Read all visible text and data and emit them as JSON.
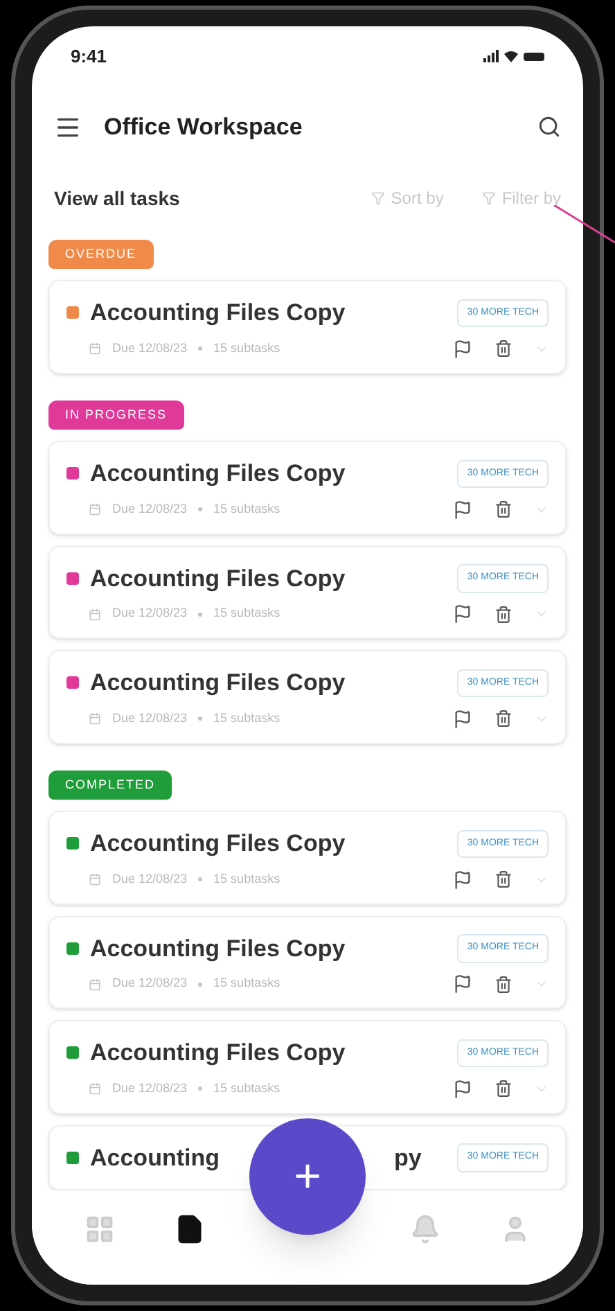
{
  "status_bar": {
    "time": "9:41"
  },
  "header": {
    "title": "Office Workspace"
  },
  "toolbar": {
    "heading": "View all tasks",
    "sort": "Sort by",
    "filter": "Filter by"
  },
  "groups": [
    {
      "label": "OVERDUE",
      "color": "#f08a4b",
      "tasks": [
        {
          "title": "Accounting Files Copy",
          "tag": "30 MORE TECH",
          "due": "Due 12/08/23",
          "subtasks": "15 subtasks"
        }
      ]
    },
    {
      "label": "IN PROGRESS",
      "color": "#e0399a",
      "tasks": [
        {
          "title": "Accounting Files Copy",
          "tag": "30 MORE TECH",
          "due": "Due 12/08/23",
          "subtasks": "15 subtasks"
        },
        {
          "title": "Accounting Files Copy",
          "tag": "30 MORE TECH",
          "due": "Due 12/08/23",
          "subtasks": "15 subtasks"
        },
        {
          "title": "Accounting Files Copy",
          "tag": "30 MORE TECH",
          "due": "Due 12/08/23",
          "subtasks": "15 subtasks"
        }
      ]
    },
    {
      "label": "COMPLETED",
      "color": "#1f9d3a",
      "tasks": [
        {
          "title": "Accounting Files Copy",
          "tag": "30 MORE TECH",
          "due": "Due 12/08/23",
          "subtasks": "15 subtasks"
        },
        {
          "title": "Accounting Files Copy",
          "tag": "30 MORE TECH",
          "due": "Due 12/08/23",
          "subtasks": "15 subtasks"
        },
        {
          "title": "Accounting Files Copy",
          "tag": "30 MORE TECH",
          "due": "Due 12/08/23",
          "subtasks": "15 subtasks"
        },
        {
          "title": "Accounting",
          "title_tail": "py",
          "tag": "30 MORE TECH"
        }
      ]
    }
  ],
  "fab": {
    "label": "+"
  },
  "nav": [
    {
      "kind": "grid",
      "selected": false
    },
    {
      "kind": "document",
      "selected": true
    },
    {
      "kind": "bell",
      "selected": false
    },
    {
      "kind": "user",
      "selected": false
    }
  ]
}
